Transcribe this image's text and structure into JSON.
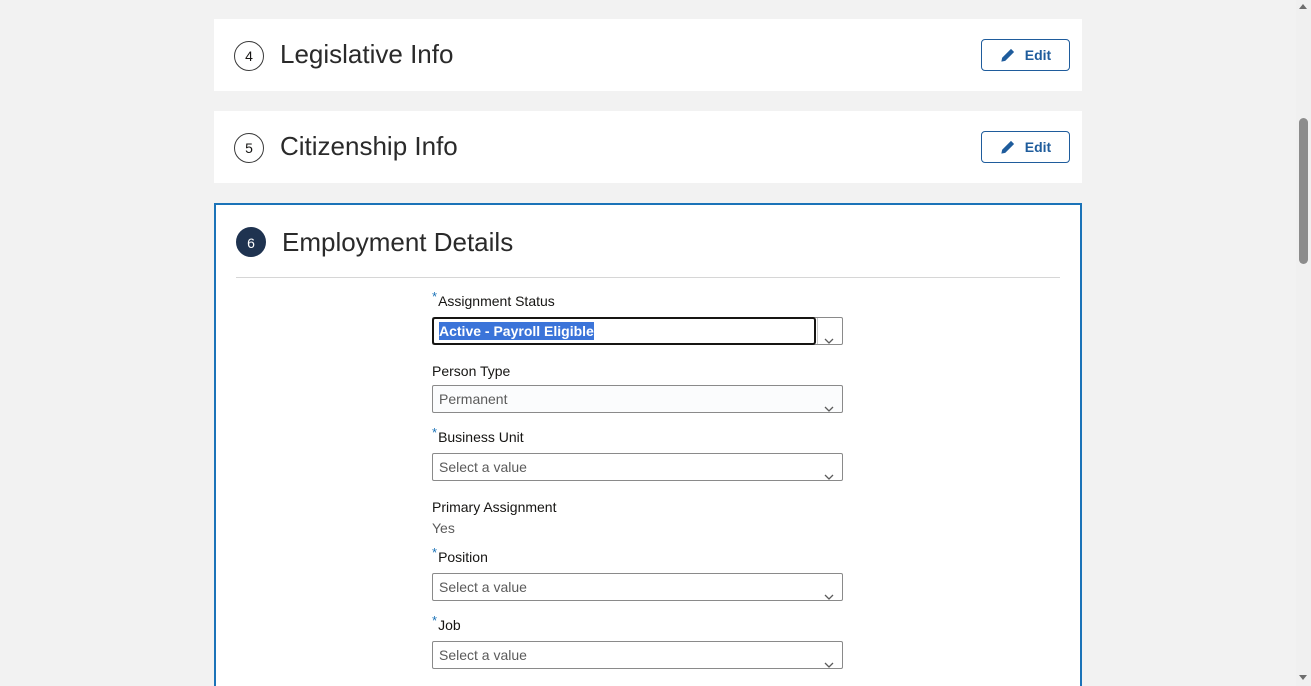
{
  "sections": {
    "legislative": {
      "step": "4",
      "title": "Legislative Info",
      "edit_label": "Edit"
    },
    "citizenship": {
      "step": "5",
      "title": "Citizenship Info",
      "edit_label": "Edit"
    },
    "employment": {
      "step": "6",
      "title": "Employment Details"
    }
  },
  "form": {
    "required_marker": "*",
    "assignment_status": {
      "label": "Assignment Status",
      "value": "Active - Payroll Eligible"
    },
    "person_type": {
      "label": "Person Type",
      "value": "Permanent"
    },
    "business_unit": {
      "label": "Business Unit",
      "placeholder": "Select a value"
    },
    "primary_assignment": {
      "label": "Primary Assignment",
      "value": "Yes"
    },
    "position": {
      "label": "Position",
      "placeholder": "Select a value"
    },
    "job": {
      "label": "Job",
      "placeholder": "Select a value"
    }
  },
  "icons": {
    "edit": "pencil-icon",
    "dropdown": "chevron-down-icon"
  },
  "colors": {
    "accent": "#1b73b8",
    "button_border": "#1f5c9c",
    "step_active_fill": "#1f3350",
    "selection_highlight": "#3b74d9",
    "page_background": "#f2f2f2"
  }
}
